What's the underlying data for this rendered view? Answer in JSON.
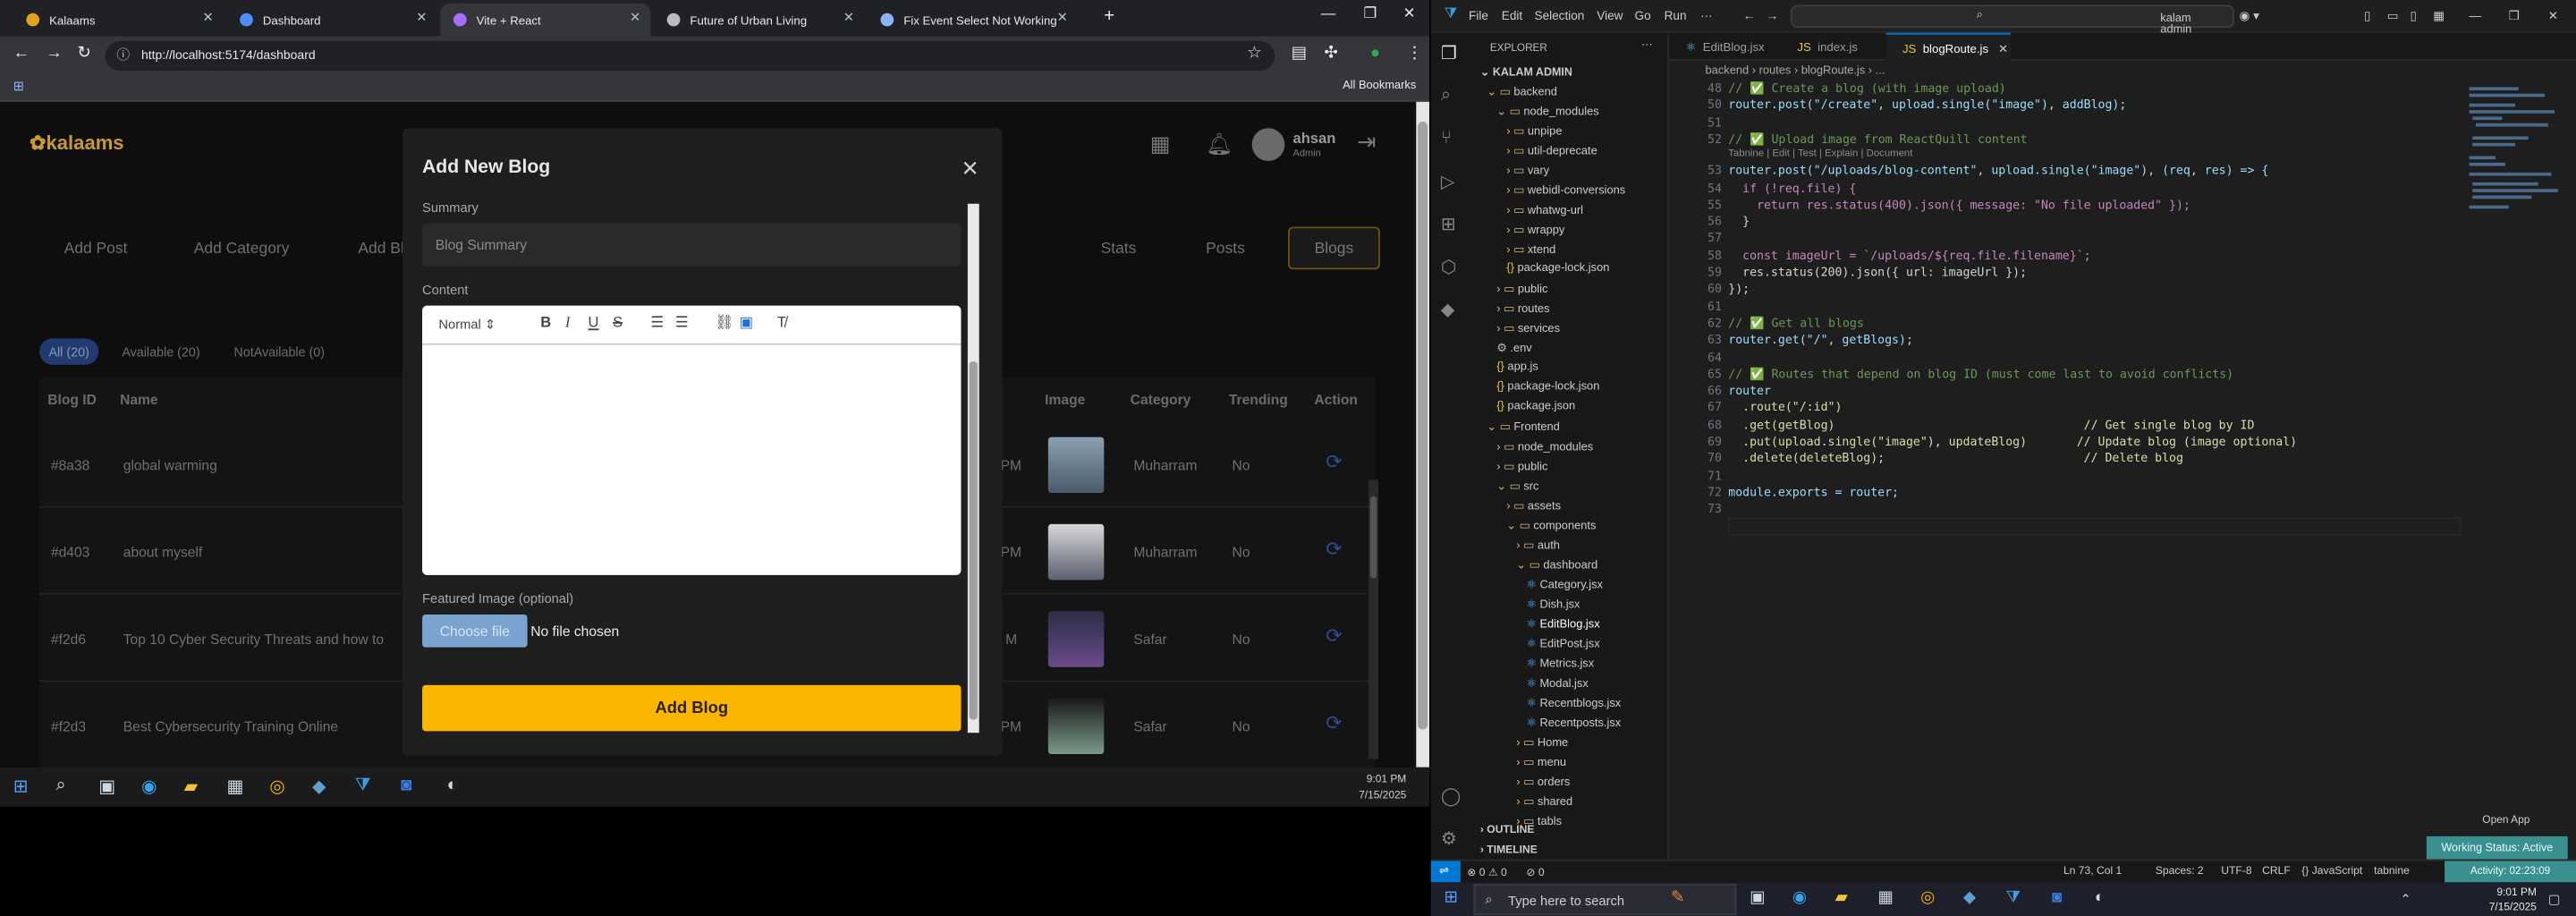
{
  "browser": {
    "tabs": [
      {
        "label": "Kalaams",
        "color": "#e3a21a"
      },
      {
        "label": "Dashboard",
        "color": "#4f8cff"
      },
      {
        "label": "Vite + React",
        "color": "#a86cff"
      },
      {
        "label": "Future of Urban Living",
        "color": "#bdbdbd"
      },
      {
        "label": "Fix Event Select Not Working in",
        "color": "#8ab4f8"
      }
    ],
    "url": "http://localhost:5174/dashboard",
    "bookmarks": "All Bookmarks"
  },
  "app": {
    "logo": "kalaams",
    "user_name": "ahsan",
    "user_role": "Admin",
    "actions": [
      "Add Post",
      "Add Category",
      "Add Bl"
    ],
    "nav": [
      "Stats",
      "Posts",
      "Blogs"
    ],
    "filters": [
      "All (20)",
      "Available (20)",
      "NotAvailable (0)"
    ],
    "table": {
      "headers": [
        "Blog ID",
        "Name",
        "Image",
        "Category",
        "Trending",
        "Action"
      ],
      "rows": [
        {
          "id": "#8a38",
          "name": "global warming",
          "time": "PM",
          "category": "Muharram",
          "trending": "No"
        },
        {
          "id": "#d403",
          "name": "about myself",
          "time": "PM",
          "category": "Muharram",
          "trending": "No"
        },
        {
          "id": "#f2d6",
          "name": "Top 10 Cyber Security Threats and how to",
          "time": "M",
          "category": "Safar",
          "trending": "No"
        },
        {
          "id": "#f2d3",
          "name": "Best Cybersecurity Training Online",
          "time": "PM",
          "category": "Safar",
          "trending": "No"
        }
      ]
    }
  },
  "modal": {
    "title": "Add New Blog",
    "summary_label": "Summary",
    "summary_placeholder": "Blog Summary",
    "content_label": "Content",
    "format_select": "Normal",
    "featured_label": "Featured Image (optional)",
    "choose_file": "Choose file",
    "no_file": "No file chosen",
    "submit": "Add Blog"
  },
  "taskbar_left": {
    "time": "9:01 PM",
    "date": "7/15/2025"
  },
  "vscode": {
    "menu": [
      "File",
      "Edit",
      "Selection",
      "View",
      "Go",
      "Run"
    ],
    "search": "kalam admin",
    "explorer_header": "EXPLORER",
    "explorer_root": "KALAM ADMIN",
    "tree": [
      "backend",
      "node_modules",
      "unpipe",
      "util-deprecate",
      "vary",
      "webidl-conversions",
      "whatwg-url",
      "wrappy",
      "xtend",
      "package-lock.json",
      "public",
      "routes",
      "services",
      ".env",
      "app.js",
      "package-lock.json",
      "package.json",
      "Frontend",
      "node_modules",
      "public",
      "src",
      "assets",
      "components",
      "auth",
      "dashboard",
      "Category.jsx",
      "Dish.jsx",
      "EditBlog.jsx",
      "EditPost.jsx",
      "Metrics.jsx",
      "Modal.jsx",
      "Recentblogs.jsx",
      "Recentposts.jsx",
      "Home",
      "menu",
      "orders",
      "shared",
      "tabls"
    ],
    "outline": "OUTLINE",
    "timeline": "TIMELINE",
    "tabs": [
      "EditBlog.jsx",
      "index.js",
      "blogRoute.js"
    ],
    "breadcrumb": "backend  ›  routes  ›  blogRoute.js  ›  ...",
    "line_numbers": [
      "48",
      "50",
      "51",
      "52",
      "53",
      "54",
      "55",
      "56",
      "57",
      "58",
      "59",
      "60",
      "61",
      "62",
      "63",
      "64",
      "65",
      "66",
      "67",
      "68",
      "69",
      "70",
      "71",
      "72",
      "73"
    ],
    "code": [
      "// ✅ Create a blog (with image upload)",
      "router.post(\"/create\", upload.single(\"image\"), addBlog);",
      "",
      "// ✅ Upload image from ReactQuill content",
      "router.post(\"/uploads/blog-content\", upload.single(\"image\"), (req, res) => {",
      "  if (!req.file) {",
      "    return res.status(400).json({ message: \"No file uploaded\" });",
      "  }",
      "",
      "  const imageUrl = `/uploads/${req.file.filename}`;",
      "  res.status(200).json({ url: imageUrl });",
      "});",
      "",
      "// ✅ Get all blogs",
      "router.get(\"/\", getBlogs);",
      "",
      "// ✅ Routes that depend on blog ID (must come last to avoid conflicts)",
      "router",
      "  .route(\"/:id\")",
      "  .get(getBlog)                                   // Get single blog by ID",
      "  .put(upload.single(\"image\"), updateBlog)       // Update blog (image optional)",
      "  .delete(deleteBlog);                            // Delete blog",
      "",
      "module.exports = router;",
      ""
    ],
    "code_hint": "Tabnine | Edit | Test | Explain | Document",
    "open_app": "Open App",
    "working_status": "Working Status: Active",
    "status": {
      "errors": "⊗ 0  ⚠ 0",
      "warn": "⊘ 0",
      "pos": "Ln 73, Col 1",
      "spaces": "Spaces: 2",
      "enc": "UTF-8",
      "eol": "CRLF",
      "lang": "{} JavaScript",
      "tabnine": "tabnine",
      "activity": "Activity: 02:23:09"
    }
  },
  "taskbar_right": {
    "search": "Type here to search",
    "time": "9:01 PM",
    "date": "7/15/2025"
  }
}
